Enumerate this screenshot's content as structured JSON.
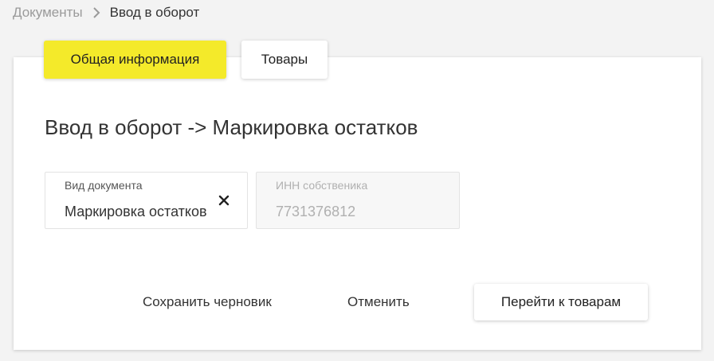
{
  "breadcrumb": {
    "parent": "Документы",
    "current": "Ввод в оборот"
  },
  "tabs": [
    {
      "label": "Общая информация",
      "active": true
    },
    {
      "label": "Товары",
      "active": false
    }
  ],
  "title": "Ввод в оборот -> Маркировка остатков",
  "fields": {
    "doc_type": {
      "label": "Вид документа",
      "value": "Маркировка остатков"
    },
    "inn": {
      "label": "ИНН собственика",
      "value": "7731376812"
    }
  },
  "actions": {
    "save_draft": "Сохранить черновик",
    "cancel": "Отменить",
    "next": "Перейти к товарам"
  },
  "colors": {
    "accent": "#f4ea2a",
    "background": "#f3f3f3",
    "card": "#ffffff"
  },
  "icons": {
    "breadcrumb_separator": "chevron-right-icon",
    "clear": "close-icon"
  }
}
